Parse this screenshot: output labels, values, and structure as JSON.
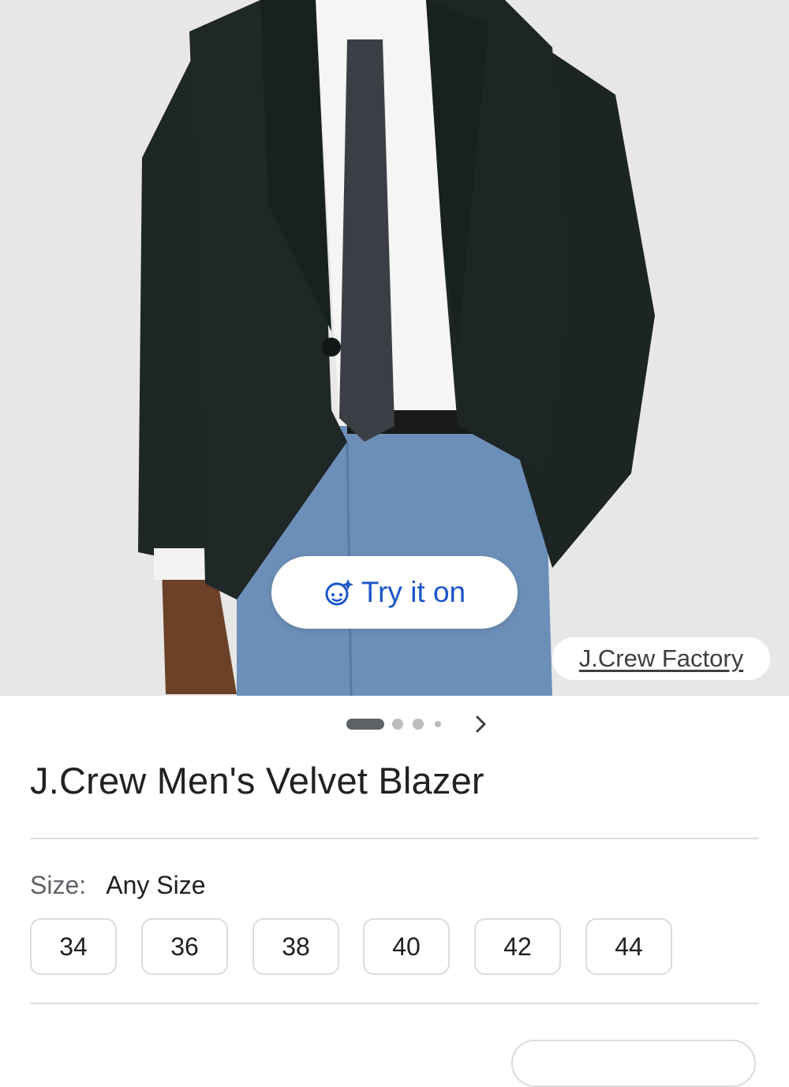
{
  "hero": {
    "image_icon": "product-photo-velvet-blazer",
    "try_on": {
      "label": "Try it on",
      "icon": "try-on-sparkle-face-icon"
    },
    "source": "J.Crew Factory",
    "carousel": {
      "count": 4,
      "active": 1
    }
  },
  "product": {
    "title": "J.Crew Men's Velvet Blazer"
  },
  "size": {
    "label": "Size:",
    "value": "Any Size",
    "options": [
      "34",
      "36",
      "38",
      "40",
      "42",
      "44"
    ]
  },
  "colors": {
    "accent": "#1a56c7",
    "divider": "#dadce0",
    "text": "#202124"
  }
}
